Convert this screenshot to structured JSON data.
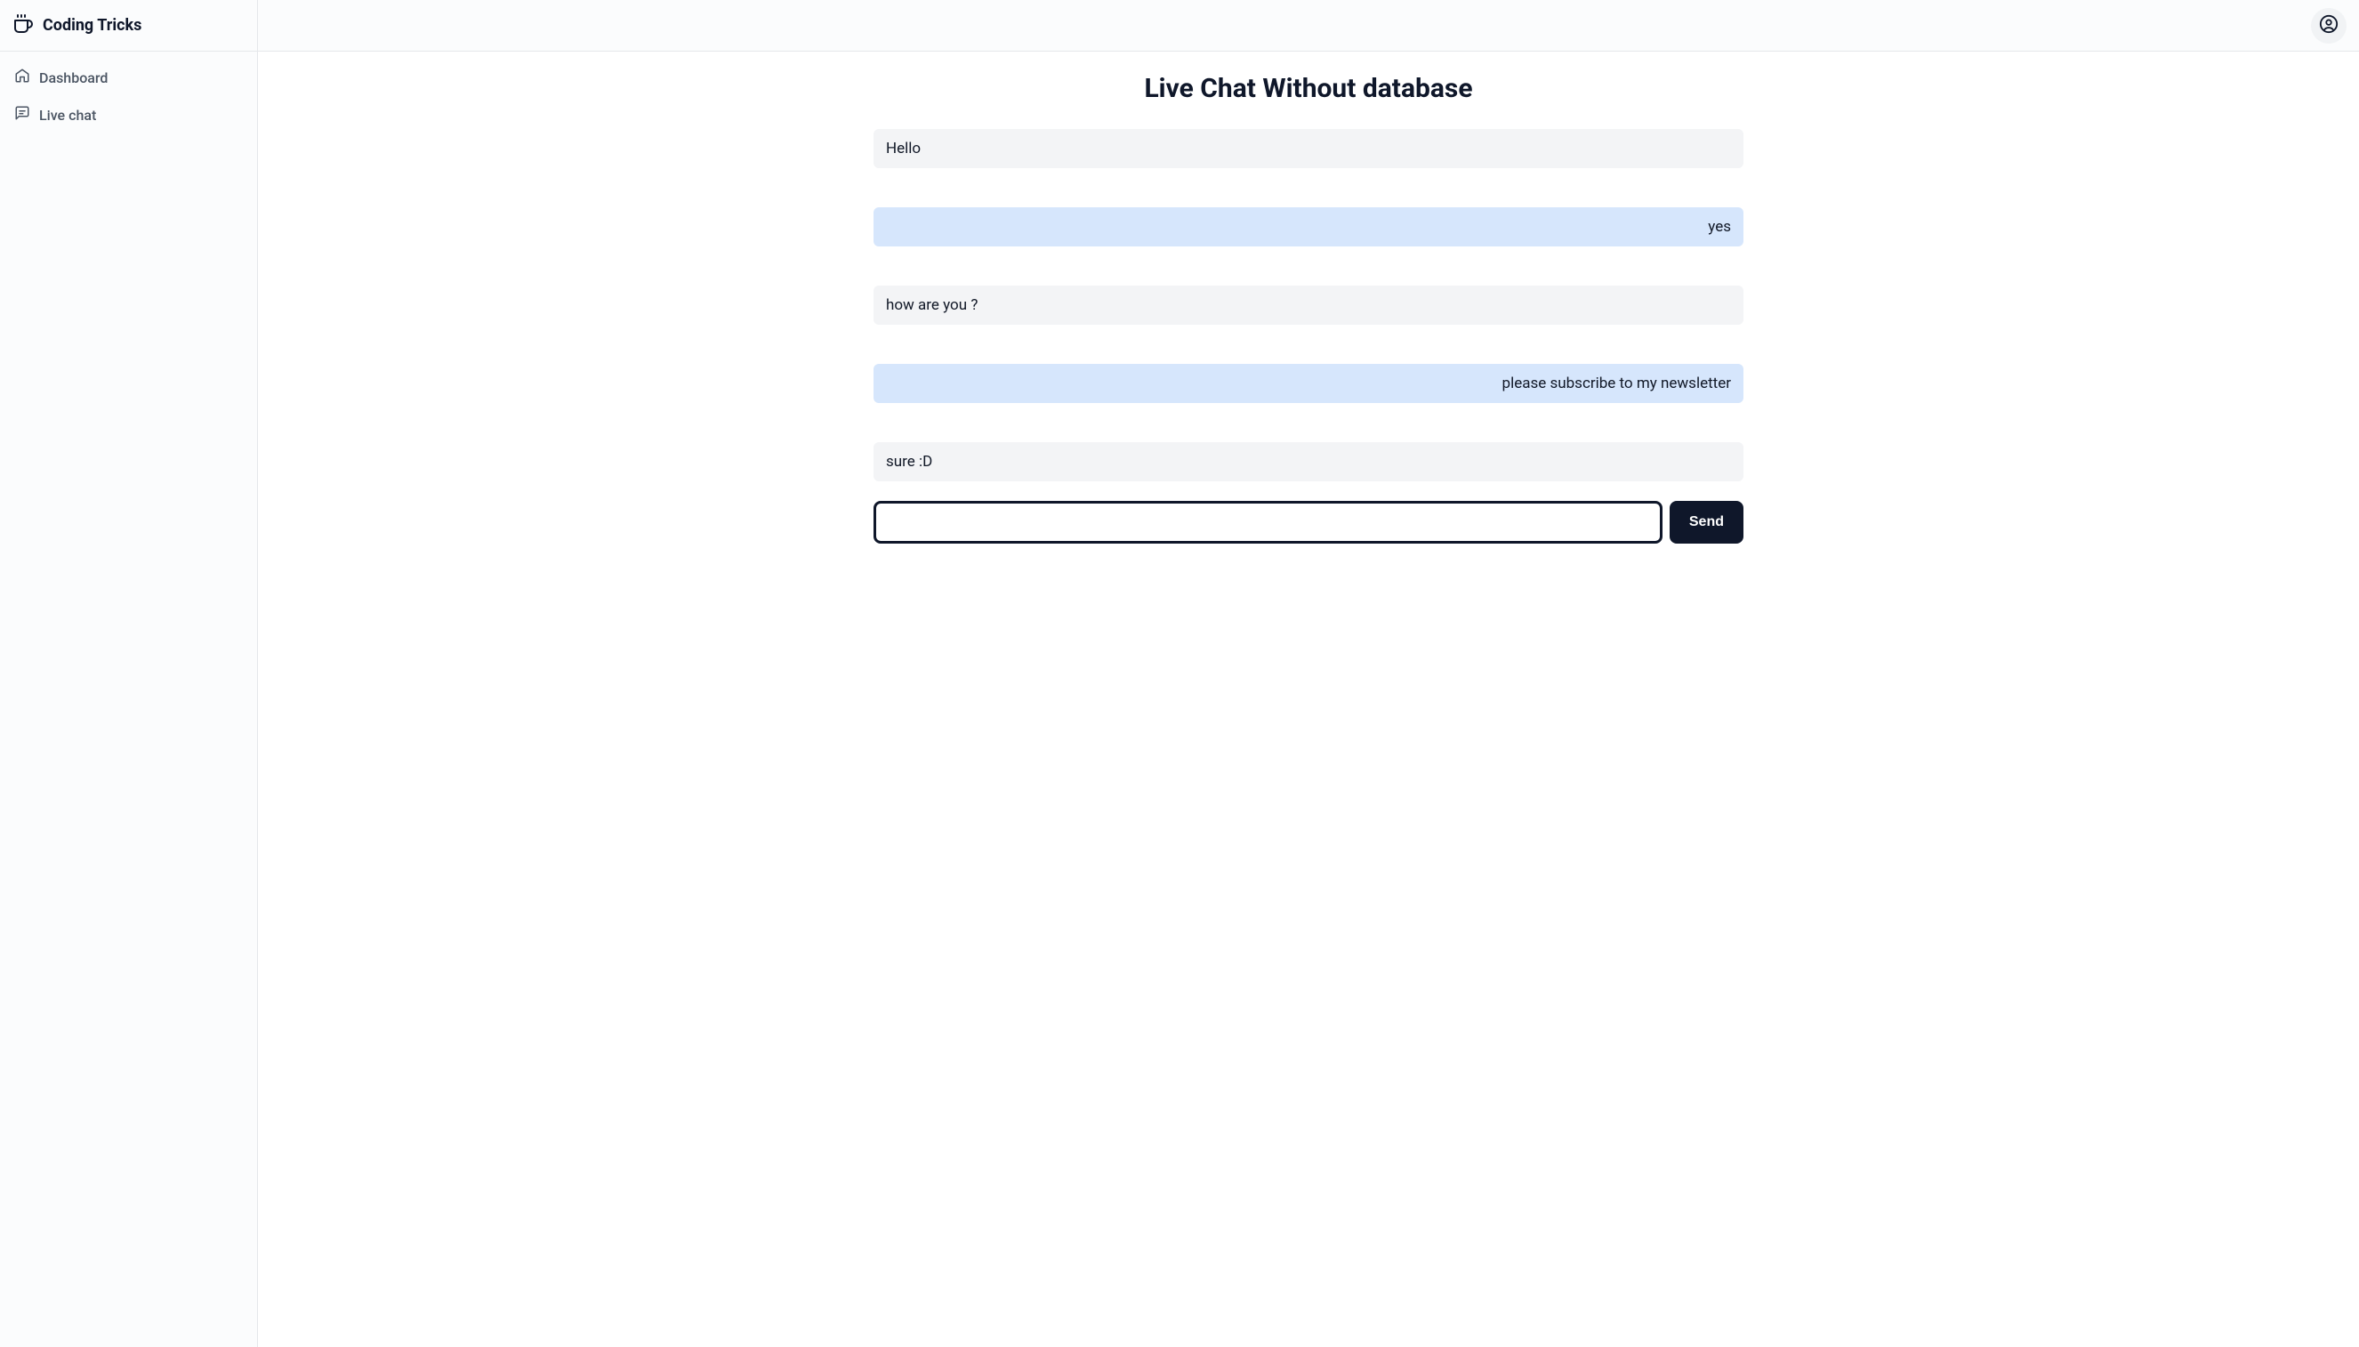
{
  "header": {
    "app_title": "Coding Tricks"
  },
  "sidebar": {
    "items": [
      {
        "icon": "home-icon",
        "label": "Dashboard"
      },
      {
        "icon": "chat-icon",
        "label": "Live chat"
      }
    ]
  },
  "main": {
    "page_title": "Live Chat Without database",
    "messages": [
      {
        "who": "other",
        "text": "Hello"
      },
      {
        "who": "mine",
        "text": "yes"
      },
      {
        "who": "other",
        "text": "how are you ?"
      },
      {
        "who": "mine",
        "text": "please subscribe to my newsletter"
      },
      {
        "who": "other",
        "text": "sure :D"
      }
    ],
    "composer": {
      "input_value": "",
      "input_placeholder": "",
      "send_label": "Send"
    }
  }
}
